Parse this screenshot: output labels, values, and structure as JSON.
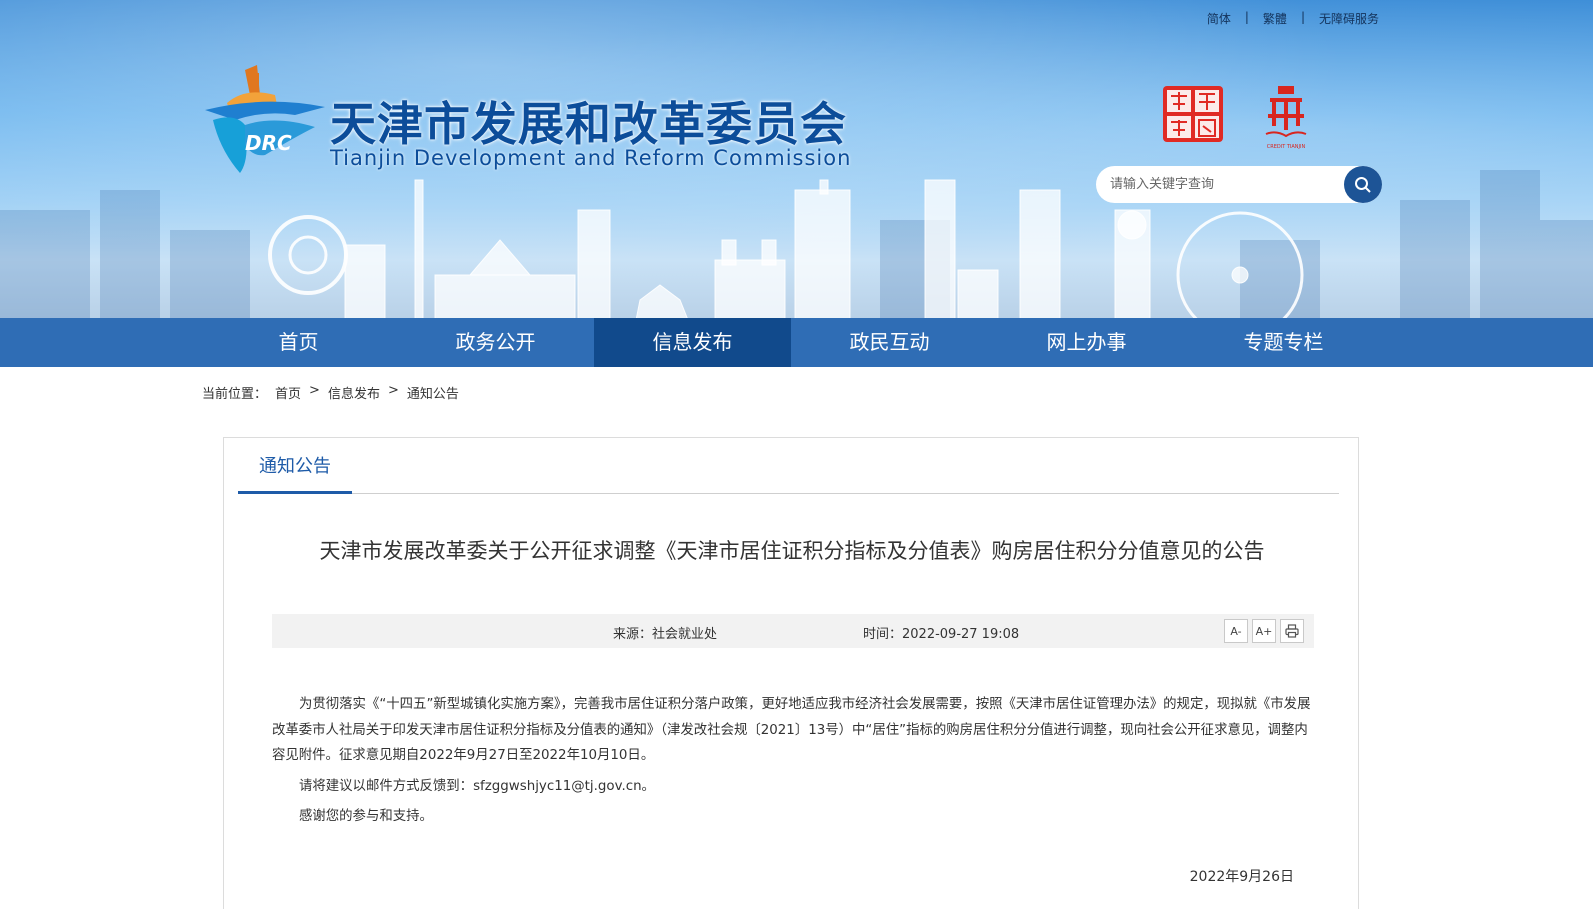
{
  "header": {
    "top_links": [
      "简体",
      "繁體",
      "无障碍服务"
    ],
    "top_link_separator": "|",
    "title": "天津市发展和改革委员会",
    "subtitle": "Tianjin Development and Reform Commission",
    "logo_text": "DRC",
    "emblem1_text": "天津政务网",
    "emblem2_text": "诚信天津",
    "emblem2_caption": "CREDIT TIANJIN",
    "search_placeholder": "请输入关键字查询",
    "search_icon": "search-icon"
  },
  "nav": {
    "items": [
      "首页",
      "政务公开",
      "信息发布",
      "政民互动",
      "网上办事",
      "专题专栏"
    ],
    "active_index": 2
  },
  "breadcrumb": {
    "label": "当前位置：",
    "items": [
      "首页",
      "信息发布",
      "通知公告"
    ],
    "separator": ">"
  },
  "panel": {
    "tab": "通知公告",
    "title": "天津市发展改革委关于公开征求调整《天津市居住证积分指标及分值表》购房居住积分分值意见的公告",
    "source": "来源：社会就业处",
    "time": "时间：2022-09-27 19:08",
    "tools": [
      "A-",
      "A+",
      "print-icon"
    ],
    "paragraphs": [
      "为贯彻落实《“十四五”新型城镇化实施方案》，完善我市居住证积分落户政策，更好地适应我市经济社会发展需要，按照《天津市居住证管理办法》的规定，现拟就《市发展改革委市人社局关于印发天津市居住证积分指标及分值表的通知》（津发改社会规〔2021〕13号）中“居住”指标的购房居住积分分值进行调整，现向社会公开征求意见，调整内容见附件。征求意见期自2022年9月27日至2022年10月10日。",
      "请将建议以邮件方式反馈到：sfzggwshjyc11@tj.gov.cn。",
      "感谢您的参与和支持。"
    ],
    "date": "2022年9月26日"
  },
  "colors": {
    "nav_bg": "#2f6db5",
    "nav_active": "#114a8c",
    "title_blue": "#0c4d9a",
    "accent": "#1e5ba8"
  }
}
